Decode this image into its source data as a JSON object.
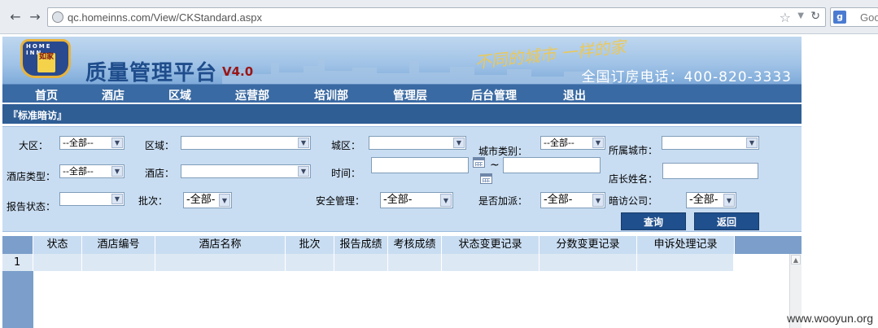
{
  "browser": {
    "url": "qc.homeinns.com/View/CKStandard.aspx",
    "search_text": "Goo",
    "search_engine_letter": "g"
  },
  "banner": {
    "logo_top": "HOME   INN",
    "logo_mark": "如家",
    "title": "质量管理平台",
    "version": "V4.0",
    "slogan": "不同的城市 一样的家",
    "hotline": "全国订房电话：400-820-3333"
  },
  "menu": [
    "首页",
    "酒店",
    "区域",
    "运营部",
    "培训部",
    "管理层",
    "后台管理",
    "退出"
  ],
  "section_title": "『标准暗访』",
  "filters": {
    "region_label": "大区：",
    "region_value": "--全部--",
    "area_label": "区域：",
    "area_value": "",
    "district_label": "城区：",
    "district_value": "",
    "city_type_label": "城市类别：",
    "city_type_value": "--全部--",
    "city_label": "所属城市：",
    "city_value": "",
    "hotel_type_label": "酒店类型：",
    "hotel_type_value": "--全部--",
    "hotel_label": "酒店：",
    "hotel_value": "",
    "time_label": "时间：",
    "time_sep": "~",
    "manager_label": "店长姓名：",
    "report_status_label": "报告状态：",
    "report_status_value": "",
    "batch_label": "批次：",
    "batch_value": "-全部-",
    "safety_label": "安全管理：",
    "safety_value": "-全部-",
    "extra_label": "是否加派：",
    "extra_value": "-全部-",
    "company_label": "暗访公司：",
    "company_value": "-全部-",
    "query_button": "查询",
    "back_button": "返回"
  },
  "table": {
    "columns": [
      "状态",
      "酒店编号",
      "酒店名称",
      "批次",
      "报告成绩",
      "考核成绩",
      "状态变更记录",
      "分数变更记录",
      "申诉处理记录"
    ],
    "rows": [
      {
        "index": "1"
      }
    ]
  },
  "watermark": "www.wooyun.org",
  "colors": {
    "menu_bg": "#3a6aa3",
    "section_bg": "#2f5e95",
    "filter_bg": "#c9ddf2",
    "button_bg": "#1f4f8c",
    "version_color": "#9b1515"
  }
}
